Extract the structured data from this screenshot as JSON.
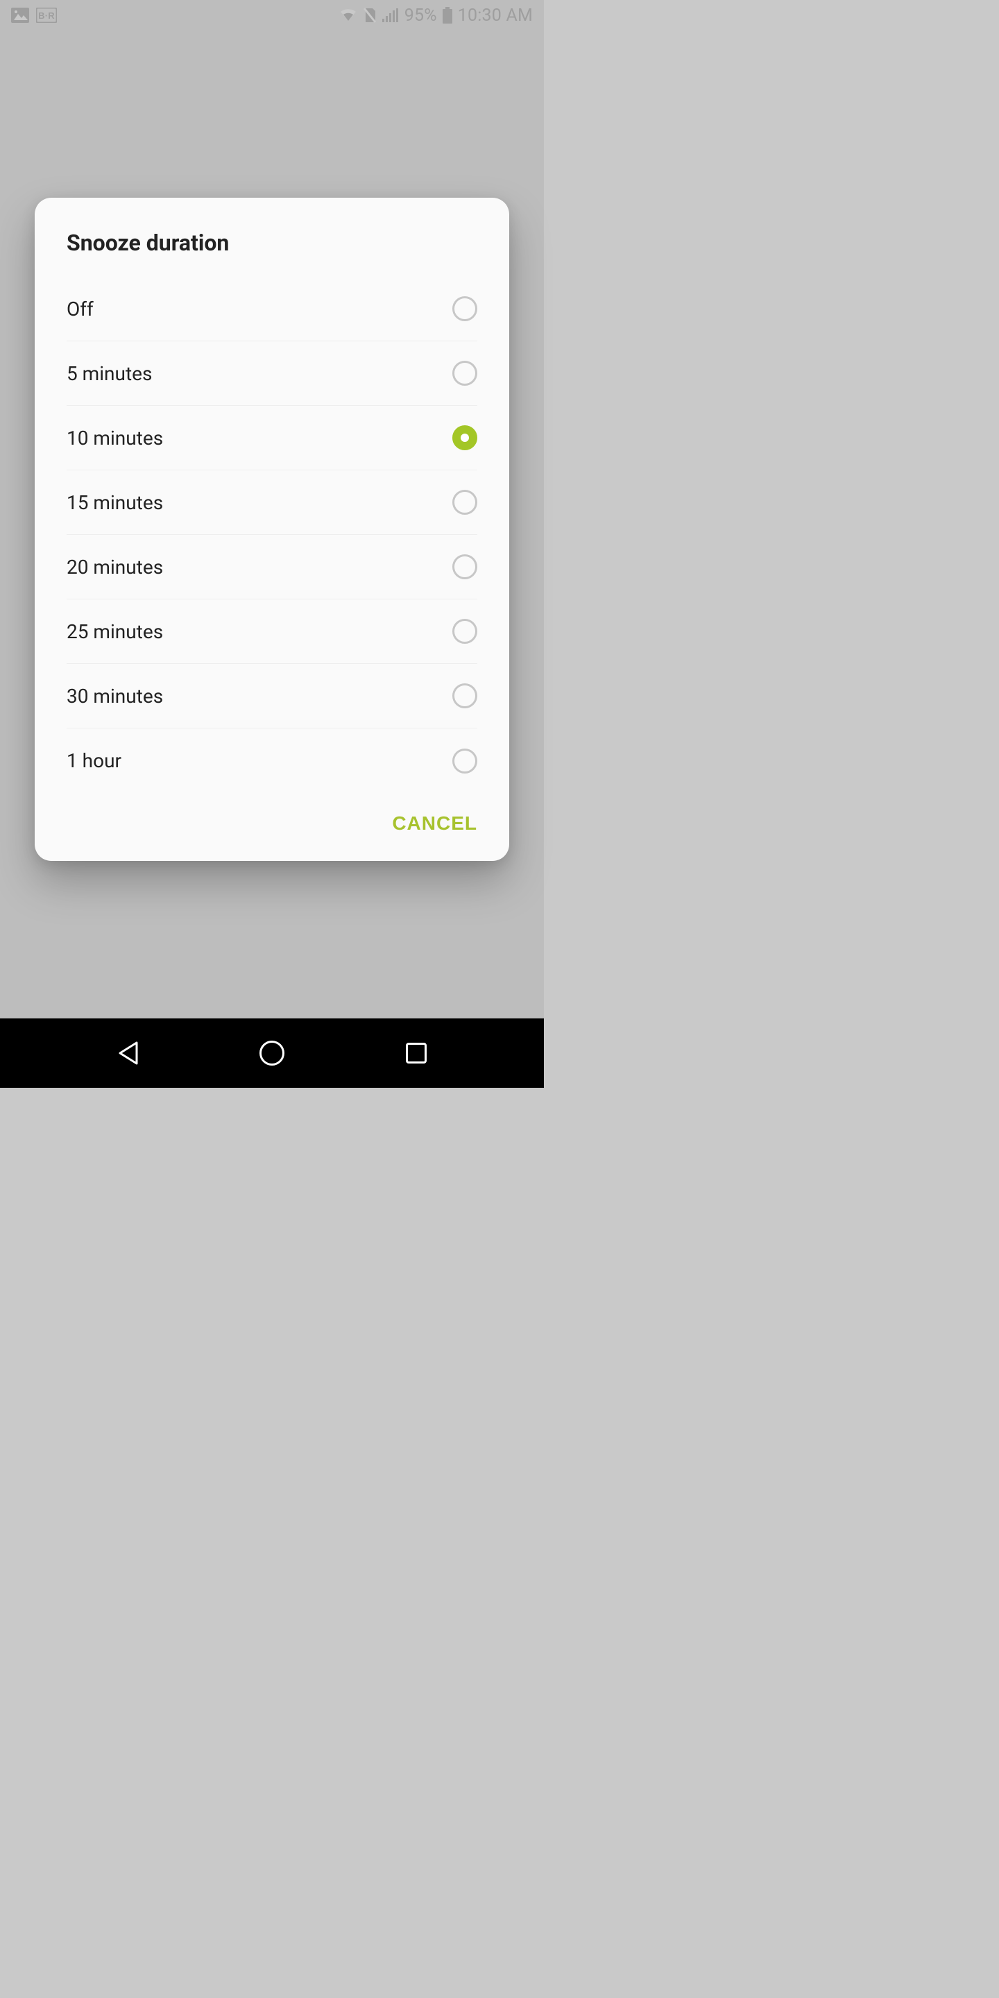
{
  "status_bar": {
    "battery_pct": "95%",
    "time": "10:30 AM"
  },
  "dialog": {
    "title": "Snooze duration",
    "options": [
      {
        "label": "Off",
        "selected": false
      },
      {
        "label": "5 minutes",
        "selected": false
      },
      {
        "label": "10 minutes",
        "selected": true
      },
      {
        "label": "15 minutes",
        "selected": false
      },
      {
        "label": "20 minutes",
        "selected": false
      },
      {
        "label": "25 minutes",
        "selected": false
      },
      {
        "label": "30 minutes",
        "selected": false
      },
      {
        "label": "1 hour",
        "selected": false
      }
    ],
    "cancel_label": "CANCEL"
  }
}
